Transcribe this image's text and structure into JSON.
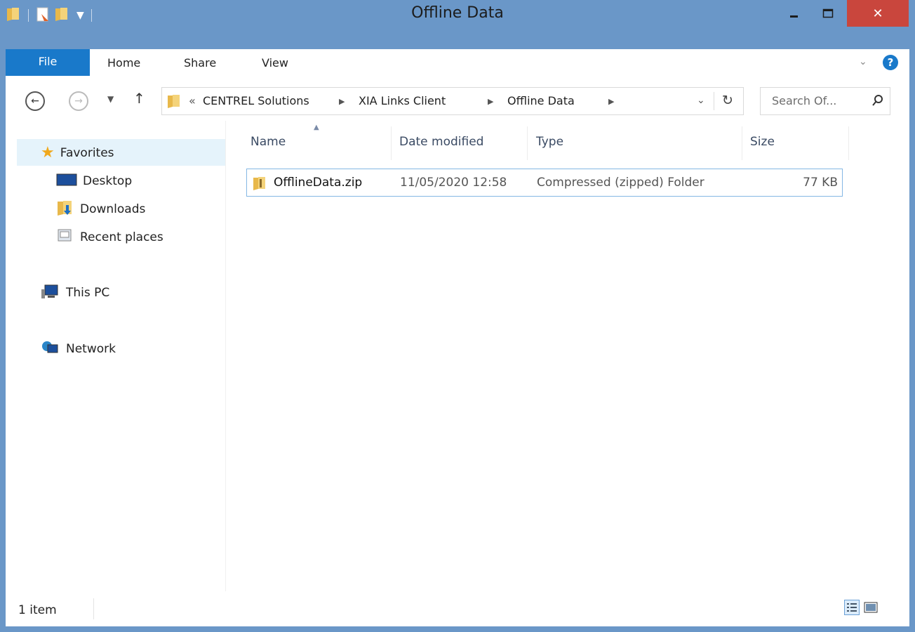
{
  "window": {
    "title": "Offline Data",
    "close_label": "✕"
  },
  "ribbon": {
    "tabs": [
      {
        "label": "File"
      },
      {
        "label": "Home"
      },
      {
        "label": "Share"
      },
      {
        "label": "View"
      }
    ]
  },
  "address": {
    "overflow": "«",
    "crumbs": [
      "CENTREL Solutions",
      "XIA Links Client",
      "Offline Data"
    ],
    "search_placeholder": "Search Of..."
  },
  "navpane": {
    "favorites_label": "Favorites",
    "items": [
      {
        "label": "Desktop"
      },
      {
        "label": "Downloads"
      },
      {
        "label": "Recent places"
      }
    ],
    "thispc_label": "This PC",
    "network_label": "Network"
  },
  "filelist": {
    "columns": [
      "Name",
      "Date modified",
      "Type",
      "Size"
    ],
    "rows": [
      {
        "name": "OfflineData.zip",
        "date": "11/05/2020 12:58",
        "type": "Compressed (zipped) Folder",
        "size": "77 KB"
      }
    ]
  },
  "status": {
    "count": "1 item"
  },
  "colors": {
    "titlebar": "#6a97c8",
    "file_tab": "#1979ca",
    "close_button": "#c9463d",
    "selection_border": "#84b7e4"
  }
}
